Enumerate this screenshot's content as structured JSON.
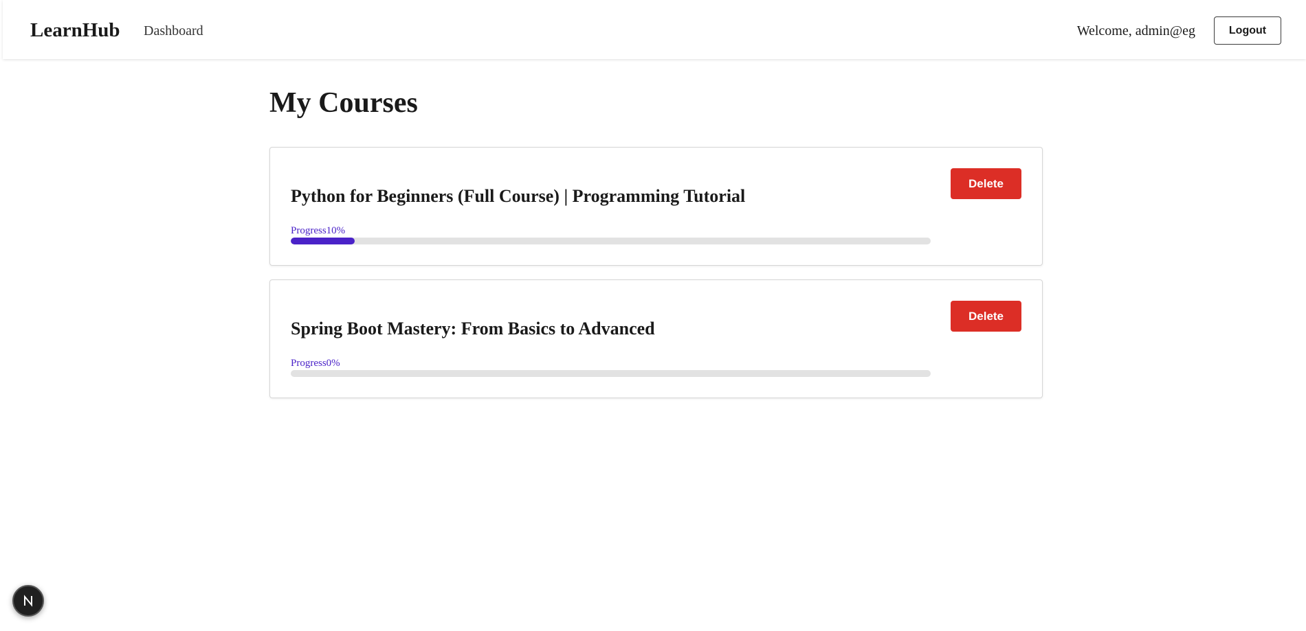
{
  "navbar": {
    "brand": "LearnHub",
    "links": [
      {
        "label": "Dashboard"
      }
    ],
    "welcome": "Welcome, admin@eg",
    "logout_label": "Logout"
  },
  "page": {
    "title": "My Courses"
  },
  "courses": [
    {
      "title": "Python for Beginners (Full Course) | Programming Tutorial",
      "progress_label": "Progress10%",
      "progress_percent": 10,
      "delete_label": "Delete"
    },
    {
      "title": "Spring Boot Mastery: From Basics to Advanced",
      "progress_label": "Progress0%",
      "progress_percent": 0,
      "delete_label": "Delete"
    }
  ],
  "dev_indicator": {
    "icon": "nextjs-logo-icon"
  },
  "colors": {
    "accent": "#4a22c8",
    "danger": "#dc2e26",
    "track": "#e2e2e2"
  }
}
